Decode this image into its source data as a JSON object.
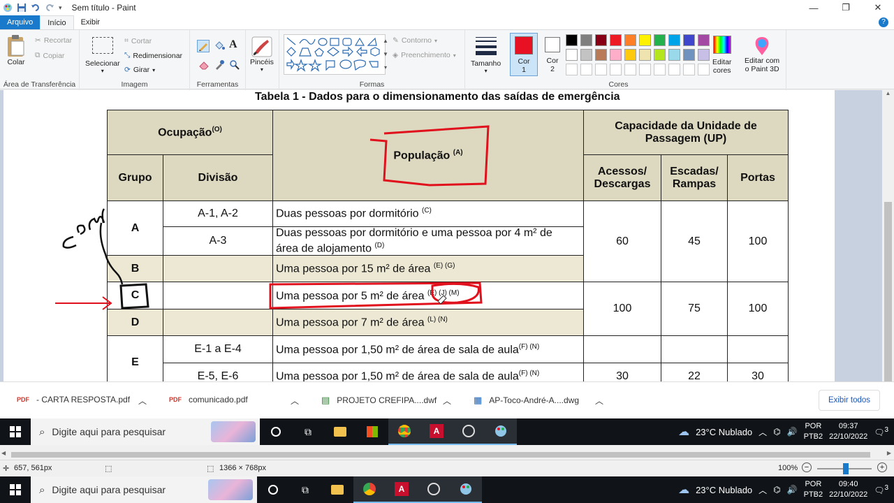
{
  "window": {
    "title": "Sem título - Paint"
  },
  "tabs": {
    "file": "Arquivo",
    "home": "Início",
    "view": "Exibir"
  },
  "ribbon": {
    "clipboard": {
      "label": "Área de Transferência",
      "paste": "Colar",
      "cut": "Recortar",
      "copy": "Copiar"
    },
    "image": {
      "label": "Imagem",
      "select": "Selecionar",
      "crop": "Cortar",
      "resize": "Redimensionar",
      "rotate": "Girar"
    },
    "tools": {
      "label": "Ferramentas"
    },
    "brushes": {
      "label": "Pincéis"
    },
    "shapes": {
      "label": "Formas",
      "outline": "Contorno",
      "fill": "Preenchimento"
    },
    "size": {
      "label": "Tamanho"
    },
    "colors": {
      "label": "Cores",
      "color1_l1": "Cor",
      "color1_l2": "1",
      "color2_l1": "Cor",
      "color2_l2": "2",
      "edit_l1": "Editar",
      "edit_l2": "cores",
      "paint3d_l1": "Editar com",
      "paint3d_l2": "o Paint 3D",
      "color1": "#e81123",
      "color2": "#ffffff",
      "palette_row1": [
        "#000000",
        "#7f7f7f",
        "#880015",
        "#ed1c24",
        "#ff7f27",
        "#fff200",
        "#22b14c",
        "#00a2e8",
        "#3f48cc",
        "#a349a4"
      ],
      "palette_row2": [
        "#ffffff",
        "#c3c3c3",
        "#b97a57",
        "#ffaec9",
        "#ffc90e",
        "#efe4b0",
        "#b5e61d",
        "#99d9ea",
        "#7092be",
        "#c8bfe7"
      ]
    }
  },
  "document": {
    "title": "Tabela 1 - Dados para o dimensionamento das saídas de emergência",
    "headers": {
      "occupation": "Ocupação",
      "occupation_sup": "(O)",
      "population": "População",
      "population_sup": "(A)",
      "capacity": "Capacidade da Unidade de Passagem (UP)",
      "group": "Grupo",
      "division": "Divisão",
      "access_l1": "Acessos/",
      "access_l2": "Descargas",
      "stairs_l1": "Escadas/",
      "stairs_l2": "Rampas",
      "doors": "Portas"
    },
    "rows": {
      "a_group": "A",
      "a1_div": "A-1, A-2",
      "a1_pop": "Duas pessoas por dormitório",
      "a1_sup": "(C)",
      "a3_div": "A-3",
      "a3_pop_l1": "Duas pessoas por dormitório e uma pessoa por 4 m² de",
      "a3_pop_l2": "área de alojamento",
      "a3_sup": "(D)",
      "b_group": "B",
      "b_pop": "Uma pessoa por 15 m² de área",
      "b_sup": "(E) (G)",
      "c_group": "C",
      "c_pop": "Uma pessoa por 5 m² de área",
      "c_sup": "(E) (J) (M)",
      "d_group": "D",
      "d_pop": "Uma pessoa por 7 m² de área",
      "d_sup": "(L) (N)",
      "e_group": "E",
      "e1_div": "E-1 a E-4",
      "e1_pop": "Uma pessoa por 1,50 m² de área de sala de aula",
      "e1_sup": "(F) (N)",
      "e5_div": "E-5, E-6",
      "e5_pop": "Uma pessoa por 1,50 m² de área de sala de aula",
      "e5_sup": "(F) (N)",
      "ab_access": "60",
      "ab_stairs": "45",
      "ab_doors": "100",
      "cd_access": "100",
      "cd_stairs": "75",
      "cd_doors": "100",
      "e_access": "30",
      "e_stairs": "22",
      "e_doors": "30"
    }
  },
  "downloads": {
    "items": [
      "- CARTA RESPOSTA.pdf",
      "comunicado.pdf",
      "PROJETO CREFIPA....dwf",
      "AP-Toco-André-A....dwg"
    ],
    "show_all": "Exibir todos"
  },
  "taskbar_inner": {
    "search": "Digite aqui para pesquisar",
    "weather": "23°C  Nublado",
    "lang1": "POR",
    "lang2": "PTB2",
    "time": "09:37",
    "date": "22/10/2022",
    "notif": "3"
  },
  "statusbar": {
    "cursor": "657, 561px",
    "dimensions": "1366 × 768px",
    "zoom": "100%"
  },
  "taskbar": {
    "search": "Digite aqui para pesquisar",
    "weather": "23°C  Nublado",
    "lang1": "POR",
    "lang2": "PTB2",
    "time": "09:40",
    "date": "22/10/2022",
    "notif": "3"
  }
}
